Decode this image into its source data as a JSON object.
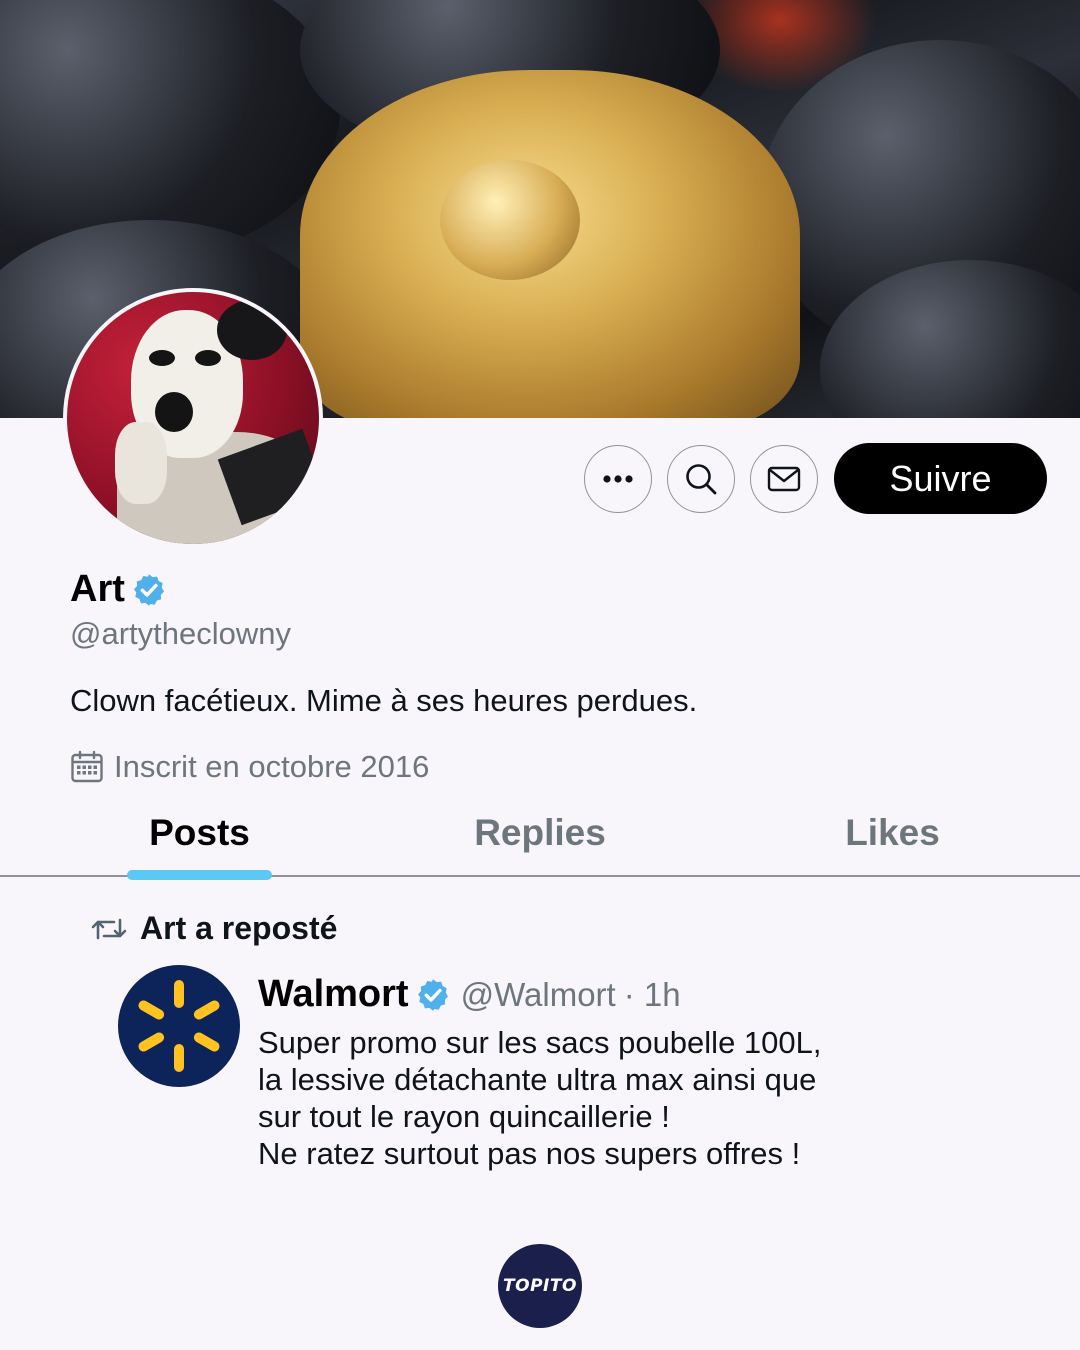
{
  "profile": {
    "name": "Art",
    "handle": "@artytheclowny",
    "bio": "Clown facétieux. Mime à ses heures perdues.",
    "joined": "Inscrit en octobre 2016",
    "verified": true
  },
  "actions": {
    "more_icon": "more-dots-icon",
    "search_icon": "search-icon",
    "message_icon": "mail-icon",
    "follow_label": "Suivre"
  },
  "tabs": [
    {
      "label": "Posts",
      "active": true
    },
    {
      "label": "Replies",
      "active": false
    },
    {
      "label": "Likes",
      "active": false
    }
  ],
  "repost": {
    "label": "Art a reposté",
    "tweet": {
      "author": "Walmort",
      "handle": "@Walmort",
      "time": "· 1h",
      "verified": true,
      "text_lines": [
        "Super promo sur les sacs poubelle 100L,",
        "la lessive détachante ultra max ainsi que",
        "sur tout le rayon quincaillerie !",
        "Ne ratez surtout pas nos supers offres !"
      ]
    }
  },
  "footer": {
    "logo_text": "TOPITO"
  },
  "colors": {
    "accent_blue": "#5cc8f5",
    "verified_blue": "#4fb0ea",
    "walmart_navy": "#0c2459",
    "walmart_yellow": "#ffc220",
    "topito_navy": "#1b1f4b"
  }
}
